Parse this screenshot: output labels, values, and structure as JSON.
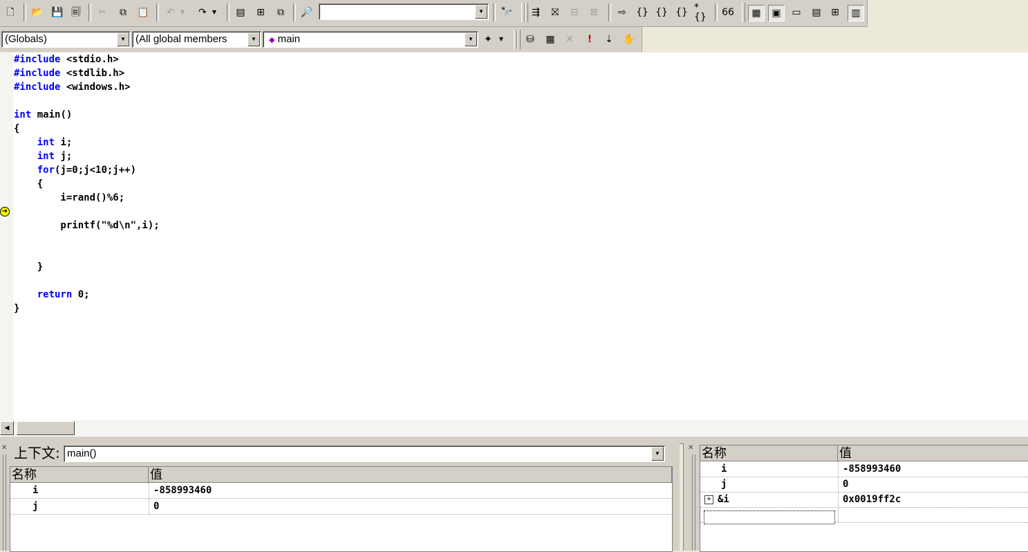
{
  "toolbar": {
    "find_value": "",
    "icons": [
      "new-file",
      "open",
      "save",
      "save-all",
      "cut",
      "copy",
      "paste",
      "undo",
      "redo",
      "workspace",
      "output",
      "window-list",
      "find-in-files",
      "find",
      "compile",
      "build",
      "stop-build",
      "build-execute",
      "go",
      "step-into",
      "step-over",
      "step-out",
      "run-to-cursor",
      "quickwatch",
      "watch-window",
      "variables-window",
      "registers-window",
      "memory-window",
      "call-stack-window",
      "disassembly-window"
    ]
  },
  "wizardbar": {
    "class_combo": "(Globals)",
    "filter_combo": "(All global members",
    "member_combo": "main"
  },
  "editor": {
    "lines": [
      [
        [
          "#include",
          "kw"
        ],
        [
          " <stdio.h>",
          ""
        ]
      ],
      [
        [
          "#include",
          "kw"
        ],
        [
          " <stdlib.h>",
          ""
        ]
      ],
      [
        [
          "#include",
          "kw"
        ],
        [
          " <windows.h>",
          ""
        ]
      ],
      [
        [
          "",
          ""
        ]
      ],
      [
        [
          "int",
          "kw"
        ],
        [
          " main()",
          ""
        ]
      ],
      [
        [
          "{",
          ""
        ]
      ],
      [
        [
          "    ",
          ""
        ],
        [
          "int",
          "kw"
        ],
        [
          " i;",
          ""
        ]
      ],
      [
        [
          "    ",
          ""
        ],
        [
          "int",
          "kw"
        ],
        [
          " j;",
          ""
        ]
      ],
      [
        [
          "    ",
          ""
        ],
        [
          "for",
          "kw"
        ],
        [
          "(j=0;j<10;j++)",
          ""
        ]
      ],
      [
        [
          "    {",
          ""
        ]
      ],
      [
        [
          "        i=rand()%6;",
          ""
        ]
      ],
      [
        [
          "",
          ""
        ]
      ],
      [
        [
          "        printf(\"%d\\n\",i);",
          ""
        ]
      ],
      [
        [
          "",
          ""
        ]
      ],
      [
        [
          "",
          ""
        ]
      ],
      [
        [
          "    }",
          ""
        ]
      ],
      [
        [
          "",
          ""
        ]
      ],
      [
        [
          "    ",
          ""
        ],
        [
          "return",
          "kw"
        ],
        [
          " 0;",
          ""
        ]
      ],
      [
        [
          "}",
          ""
        ]
      ]
    ],
    "current_line": 11
  },
  "variables_pane": {
    "context_label": "上下文:",
    "context_value": "main()",
    "header_name": "名称",
    "header_value": "值",
    "rows": [
      {
        "name": "i",
        "value": "-858993460"
      },
      {
        "name": "j",
        "value": "0"
      }
    ]
  },
  "watch_pane": {
    "header_name": "名称",
    "header_value": "值",
    "rows": [
      {
        "name": "i",
        "value": "-858993460",
        "expandable": false
      },
      {
        "name": "j",
        "value": "0",
        "expandable": false
      },
      {
        "name": "&i",
        "value": "0x0019ff2c",
        "expandable": true
      }
    ],
    "expand_symbol": "+"
  },
  "colors": {
    "keyword": "#0000ff",
    "chrome": "#d4d0c8",
    "exec_arrow": "#ffff00"
  }
}
